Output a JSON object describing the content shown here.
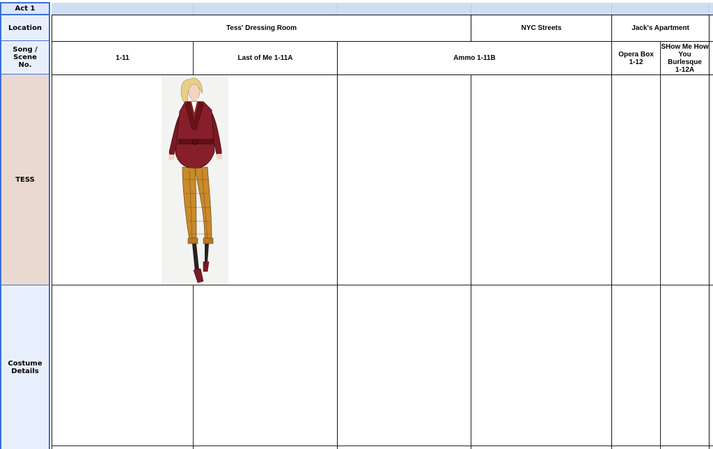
{
  "act_label": "Act 1",
  "row_headers": {
    "location": "Location",
    "song_scene_line1": "Song / Scene",
    "song_scene_line2": "No.",
    "tess": "TESS",
    "costume_line1": "Costume",
    "costume_line2": "Details"
  },
  "locations": [
    "Tess' Dressing Room",
    "NYC Streets",
    "Jack's Apartment"
  ],
  "scenes": {
    "s1": "1-11",
    "s2": "Last of Me 1-11A",
    "s3": "Ammo 1-11B",
    "s4_line1": "Opera Box",
    "s4_line2": "1-12",
    "s5_line1": "SHow Me How",
    "s5_line2": "You",
    "s5_line3": "Burlesque",
    "s5_line4": "1-12A"
  },
  "colors": {
    "selection_blue": "#3a6fd8",
    "header_bg": "#e8effc",
    "tess_bg": "#ead9d0",
    "coat": "#7a1a22",
    "pants": "#c98a2a"
  },
  "sketch": {
    "icon": "costume-sketch-figure"
  }
}
